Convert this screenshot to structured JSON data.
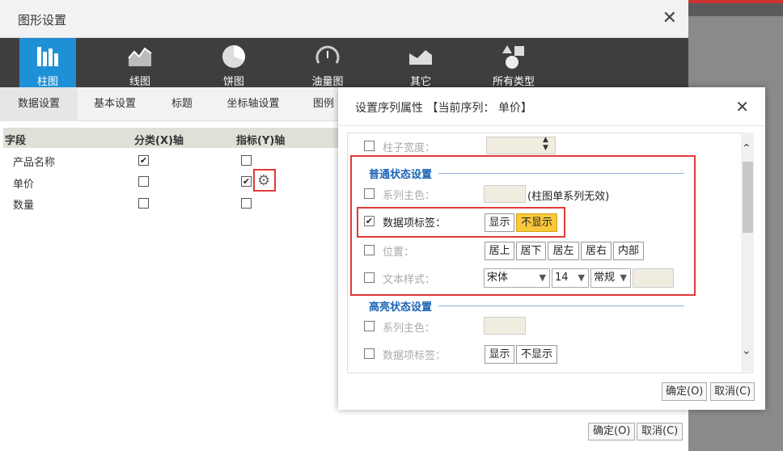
{
  "outer_dialog": {
    "title": "图形设置",
    "close": "✕",
    "chart_types": [
      {
        "label": "柱图",
        "icon": "bar-chart-icon",
        "active": true
      },
      {
        "label": "线图",
        "icon": "line-chart-icon"
      },
      {
        "label": "饼图",
        "icon": "pie-chart-icon"
      },
      {
        "label": "油量图",
        "icon": "gauge-icon"
      },
      {
        "label": "其它",
        "icon": "area-chart-icon"
      },
      {
        "label": "所有类型",
        "icon": "shapes-icon"
      }
    ],
    "tabs": [
      "数据设置",
      "基本设置",
      "标题",
      "坐标轴设置",
      "图例"
    ],
    "grid": {
      "headers": [
        "字段",
        "分类(X)轴",
        "指标(Y)轴"
      ],
      "rows": [
        {
          "field": "产品名称",
          "x_checked": true,
          "y_checked": false
        },
        {
          "field": "单价",
          "x_checked": false,
          "y_checked": true
        },
        {
          "field": "数量",
          "x_checked": false,
          "y_checked": false
        }
      ]
    },
    "footer": {
      "ok": "确定(O)",
      "cancel": "取消(C)"
    }
  },
  "inner_dialog": {
    "title": "设置序列属性 【当前序列： 单价】",
    "close": "✕",
    "bar_width_label": "柱子宽度：",
    "normal_section": "普通状态设置",
    "series_color_label": "系列主色：",
    "series_color_note": "(柱图单系列无效)",
    "data_label_label": "数据项标签：",
    "show": "显示",
    "hide": "不显示",
    "position_label": "位置：",
    "positions": [
      "居上",
      "居下",
      "居左",
      "居右",
      "内部"
    ],
    "text_style_label": "文本样式：",
    "font_family": "宋体",
    "font_size": "14",
    "font_weight": "常规",
    "highlight_section": "高亮状态设置",
    "hl_series_color_label": "系列主色：",
    "hl_data_label_label": "数据项标签：",
    "hl_show": "显示",
    "hl_hide": "不显示",
    "footer": {
      "ok": "确定(O)",
      "cancel": "取消(C)"
    }
  },
  "colors": {
    "accent": "#1e90d6",
    "selected": "#f9c93b",
    "highlight_border": "#e03a3a",
    "section_title": "#1a64b8"
  }
}
